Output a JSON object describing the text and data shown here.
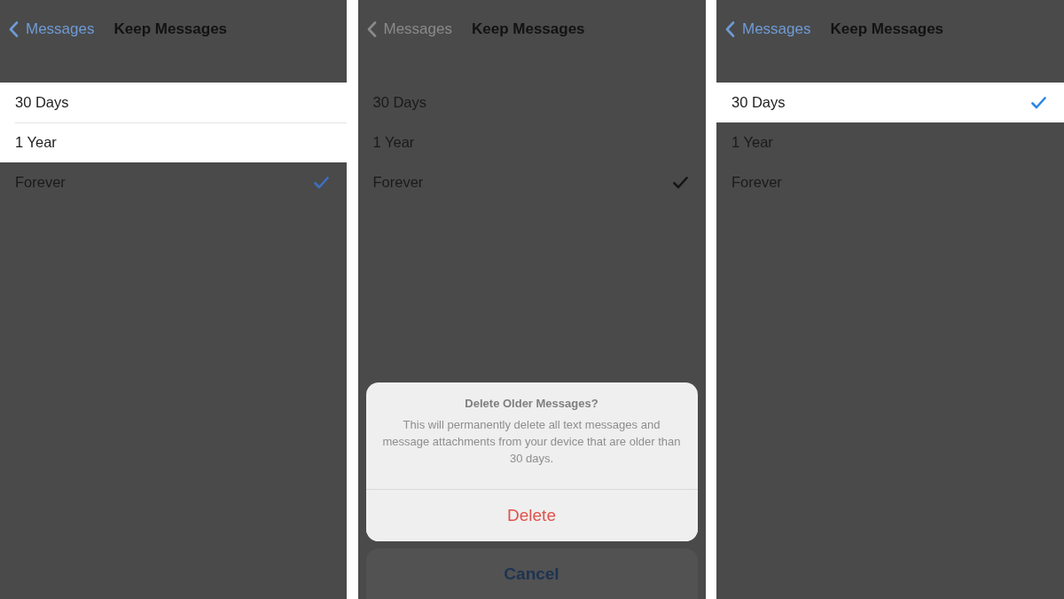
{
  "panels": [
    {
      "nav": {
        "back_label": "Messages",
        "title": "Keep Messages"
      },
      "options": [
        {
          "label": "30 Days",
          "selected": false,
          "highlighted": true
        },
        {
          "label": "1 Year",
          "selected": false,
          "highlighted": true
        },
        {
          "label": "Forever",
          "selected": true,
          "highlighted": false
        }
      ]
    },
    {
      "nav": {
        "back_label": "Messages",
        "title": "Keep Messages"
      },
      "options": [
        {
          "label": "30 Days",
          "selected": false,
          "highlighted": false
        },
        {
          "label": "1 Year",
          "selected": false,
          "highlighted": false
        },
        {
          "label": "Forever",
          "selected": true,
          "highlighted": false
        }
      ],
      "action_sheet": {
        "title": "Delete Older Messages?",
        "message": "This will permanently delete all text messages and message attachments from your device that are older than 30 days.",
        "actions": [
          {
            "label": "Delete",
            "kind": "destructive"
          }
        ],
        "cancel": "Cancel"
      }
    },
    {
      "nav": {
        "back_label": "Messages",
        "title": "Keep Messages"
      },
      "options": [
        {
          "label": "30 Days",
          "selected": true,
          "highlighted": true
        },
        {
          "label": "1 Year",
          "selected": false,
          "highlighted": false
        },
        {
          "label": "Forever",
          "selected": false,
          "highlighted": false
        }
      ]
    }
  ]
}
